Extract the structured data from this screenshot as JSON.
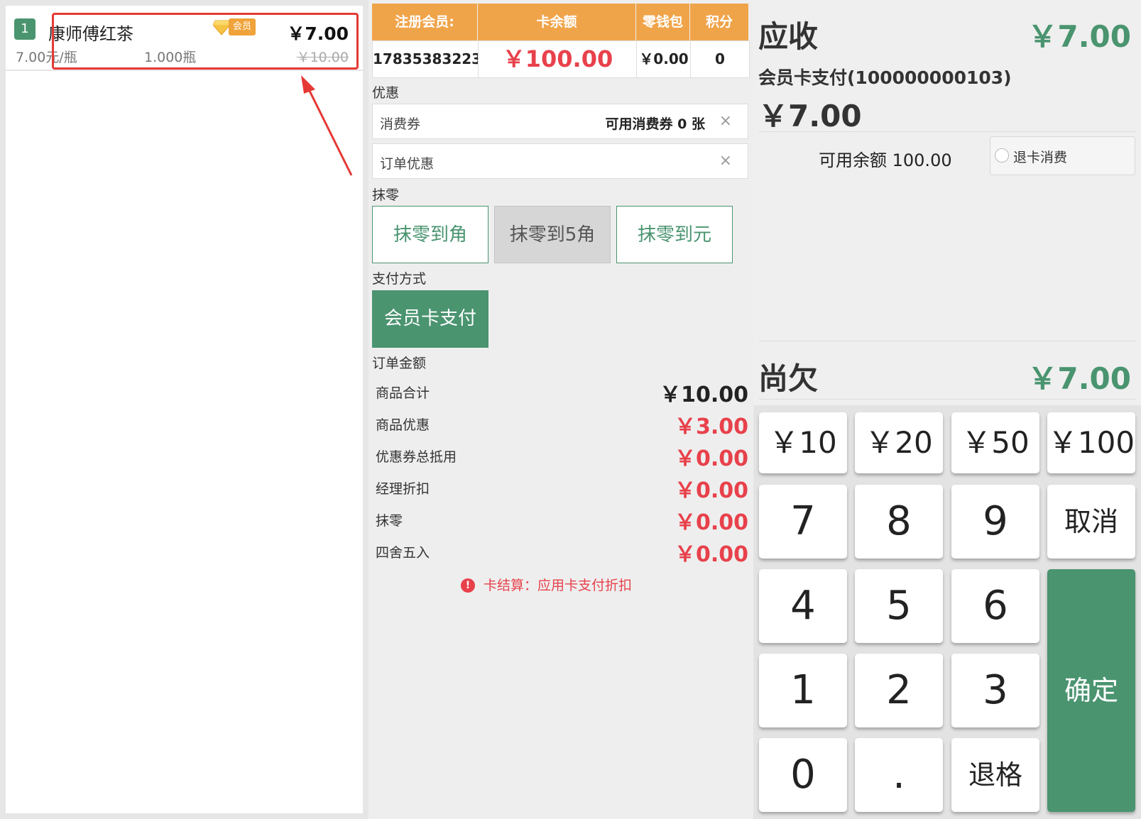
{
  "cart": {
    "items": [
      {
        "index": "1",
        "name": "康师傅红茶",
        "badge": "会员",
        "price": "￥7.00",
        "unit_price": "7.00元/瓶",
        "quantity": "1.000瓶",
        "original_price": "￥10.00"
      }
    ]
  },
  "member": {
    "headers": [
      "注册会员:",
      "卡余额",
      "零钱包",
      "积分"
    ],
    "values": [
      "17835383223",
      "￥100.00",
      "￥0.00",
      "0"
    ]
  },
  "discount": {
    "section_label": "优惠",
    "coupon_label": "消费券",
    "coupon_available": "可用消费券 0 张",
    "order_discount_label": "订单优惠",
    "clear_icon": "×"
  },
  "rounding": {
    "section_label": "抹零",
    "buttons": [
      "抹零到角",
      "抹零到5角",
      "抹零到元"
    ]
  },
  "payment": {
    "section_label": "支付方式",
    "method": "会员卡支付"
  },
  "order_amount": {
    "section_label": "订单金额",
    "rows": [
      {
        "label": "商品合计",
        "value": "￥10.00"
      },
      {
        "label": "商品优惠",
        "value": "￥3.00"
      },
      {
        "label": "优惠券总抵用",
        "value": "￥0.00"
      },
      {
        "label": "经理折扣",
        "value": "￥0.00"
      },
      {
        "label": "抹零",
        "value": "￥0.00"
      },
      {
        "label": "四舍五入",
        "value": "￥0.00"
      }
    ],
    "notice_icon": "!",
    "notice": "卡结算：应用卡支付折扣"
  },
  "summary": {
    "receivable_label": "应收",
    "receivable_value": "￥7.00",
    "card_payment_label": "会员卡支付(100000000103)",
    "card_payment_value": "￥7.00",
    "available_balance": "可用余额 100.00",
    "refund_label": "退卡消费",
    "owed_label": "尚欠",
    "owed_value": "￥7.00"
  },
  "keypad": {
    "quick_amounts": [
      "￥10",
      "￥20",
      "￥50",
      "￥100"
    ],
    "digits": [
      "7",
      "8",
      "9",
      "4",
      "5",
      "6",
      "1",
      "2",
      "3",
      "0",
      "."
    ],
    "cancel": "取消",
    "backspace": "退格",
    "confirm": "确定"
  },
  "colors": {
    "accent_green": "#4a9470",
    "header_orange": "#f0a44a",
    "discount_red": "#e8414b",
    "annotation_red": "#e53935"
  }
}
